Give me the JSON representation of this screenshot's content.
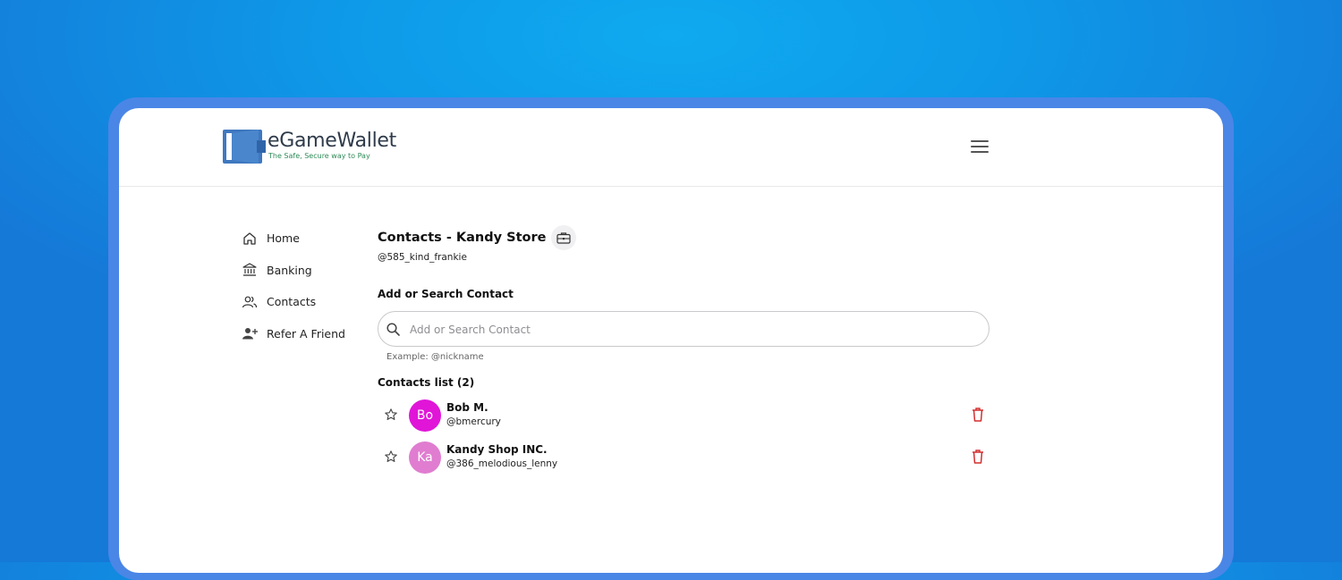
{
  "brand": {
    "name": "eGameWallet",
    "tagline": "The Safe, Secure way to Pay",
    "color": "#4a7fc1"
  },
  "header": {
    "menu_icon": "hamburger-menu-icon"
  },
  "sidebar": {
    "items": [
      {
        "label": "Home",
        "icon": "home-icon"
      },
      {
        "label": "Banking",
        "icon": "bank-icon"
      },
      {
        "label": "Contacts",
        "icon": "contacts-icon"
      },
      {
        "label": "Refer A Friend",
        "icon": "add-user-icon"
      }
    ]
  },
  "main": {
    "title": "Contacts - Kandy Store",
    "title_icon": "briefcase-icon",
    "handle": "@585_kind_frankie",
    "search": {
      "label": "Add or Search Contact",
      "placeholder": "Add or Search Contact",
      "value": "",
      "helper": "Example: @nickname"
    },
    "contacts_title": "Contacts list (2)",
    "contacts": [
      {
        "initials": "Bo",
        "name": "Bob M.",
        "handle": "@bmercury",
        "avatar_color": "#e015d8"
      },
      {
        "initials": "Ka",
        "name": "Kandy Shop INC.",
        "handle": "@386_melodious_lenny",
        "avatar_color": "#e07dd0"
      }
    ]
  },
  "colors": {
    "background_gradient_center": "#0faaf0",
    "background_gradient_edge": "#1579d8",
    "frame": "#4a86e6",
    "delete": "#d32f2f"
  }
}
